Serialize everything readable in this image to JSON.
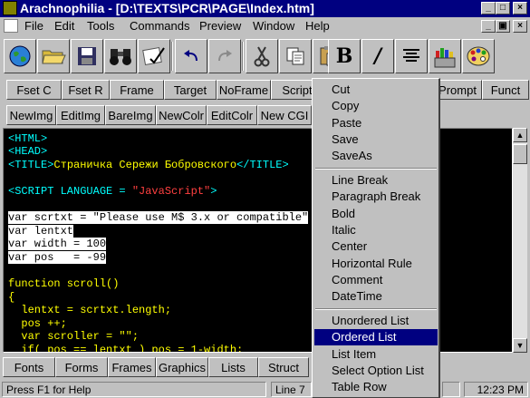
{
  "window": {
    "title": "Arachnophilia - [D:\\TEXTS\\PCR\\PAGE\\Index.htm]",
    "minimize_glyph": "_",
    "maximize_glyph": "□",
    "close_glyph": "×",
    "restore_glyph": "▣"
  },
  "menubar": {
    "items": [
      "File",
      "Edit",
      "Tools",
      "Commands",
      "Preview",
      "Window",
      "Help"
    ]
  },
  "toolbar": {
    "icons": [
      "globe-icon",
      "folder-open-icon",
      "save-icon",
      "binoculars-icon",
      "spellcheck-icon",
      "undo-icon",
      "redo-icon",
      "cut-icon",
      "copy-icon",
      "paste-icon",
      "bold-icon",
      "italic-icon",
      "center-icon",
      "crayons-icon",
      "palette-icon"
    ],
    "bold_glyph": "B",
    "italic_glyph": "/"
  },
  "row1": {
    "buttons": [
      "Fset C",
      "Fset R",
      "Frame",
      "Target",
      "NoFrame",
      "Script",
      "Prompt",
      "Funct"
    ]
  },
  "row2": {
    "buttons": [
      "NewImg",
      "EditImg",
      "BareImg",
      "NewColr",
      "EditColr",
      "New CGI"
    ]
  },
  "editor": {
    "lines": [
      "<HTML>",
      "<HEAD>",
      "<TITLE>",
      "Страничка Сережи Бобровского",
      "</TITLE>",
      "<SCRIPT LANGUAGE = ",
      "\"JavaScript\"",
      ">",
      "var scrtxt = \"Please use M$ 3.x or compatible\"",
      "var lentxt",
      "var width = 100",
      "var pos   = -99",
      "function scroll()",
      "{",
      "  lentxt = scrtxt.length;",
      "  pos ++;",
      "  var scroller = \"\";",
      "  if( pos == lentxt ) pos = 1-width;"
    ]
  },
  "bottom": {
    "buttons": [
      "Fonts",
      "Forms",
      "Frames",
      "Graphics",
      "Lists",
      "Struct"
    ]
  },
  "status": {
    "help": "Press F1 for Help",
    "line_label": "Line",
    "line_value": "7",
    "time": "12:23 PM"
  },
  "context_menu": {
    "groups": [
      [
        "Cut",
        "Copy",
        "Paste",
        "Save",
        "SaveAs"
      ],
      [
        "Line Break",
        "Paragraph Break",
        "Bold",
        "Italic",
        "Center",
        "Horizontal Rule",
        "Comment",
        "DateTime"
      ],
      [
        "Unordered List",
        "Ordered List",
        "List Item",
        "Select Option List",
        "Table Row"
      ]
    ],
    "highlighted": "Ordered List"
  },
  "colors": {
    "title_bar": "#000080",
    "editor_bg": "#000000",
    "tag": "#00ffff",
    "string": "#ff4040",
    "code": "#ffff00",
    "highlight": "#000080"
  }
}
